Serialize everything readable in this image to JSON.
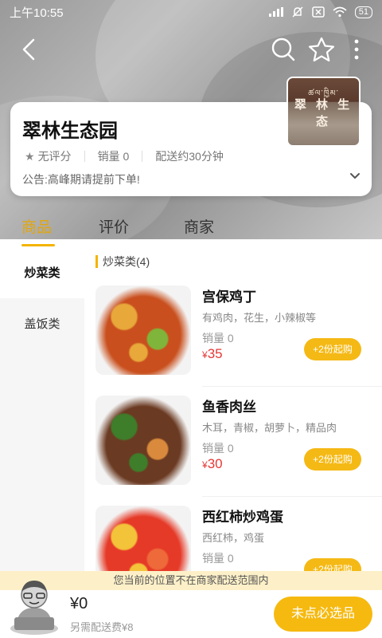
{
  "status_bar": {
    "time": "上午10:55",
    "battery": "51"
  },
  "store": {
    "name": "翠林生态园",
    "rating": "无评分",
    "sales": "销量 0",
    "delivery": "配送约30分钟",
    "notice": "公告:高峰期请提前下单!",
    "logo_text": "翠 林 生 态",
    "logo_script": "ཚལ་ཁྱིམ་"
  },
  "tabs": [
    {
      "label": "商品",
      "active": true
    },
    {
      "label": "评价",
      "active": false
    },
    {
      "label": "商家",
      "active": false
    }
  ],
  "categories": [
    {
      "label": "炒菜类",
      "active": true
    },
    {
      "label": "盖饭类",
      "active": false
    }
  ],
  "list": {
    "header": "炒菜类(4)",
    "dishes": [
      {
        "name": "宫保鸡丁",
        "desc": "有鸡肉，花生，小辣椒等",
        "sales": "销量 0",
        "price": "35",
        "currency": "¥",
        "min_label": "+2份起购",
        "palette": [
          "#c9501e",
          "#e8a83a",
          "#7fb53a"
        ]
      },
      {
        "name": "鱼香肉丝",
        "desc": "木耳，青椒，胡萝卜，精品肉",
        "sales": "销量 0",
        "price": "30",
        "currency": "¥",
        "min_label": "+2份起购",
        "palette": [
          "#6b3a22",
          "#3e7d2a",
          "#d98a3c"
        ]
      },
      {
        "name": "西红柿炒鸡蛋",
        "desc": "西红柿，鸡蛋",
        "sales": "销量 0",
        "price": "",
        "currency": "",
        "min_label": "+2份起购",
        "palette": [
          "#e63a28",
          "#f3c33a",
          "#ee6a3a"
        ]
      }
    ]
  },
  "range_notice": "您当前的位置不在商家配送范围内",
  "cart": {
    "total": "¥0",
    "delivery_fee": "另需配送费¥8",
    "checkout_label": "未点必选品"
  }
}
